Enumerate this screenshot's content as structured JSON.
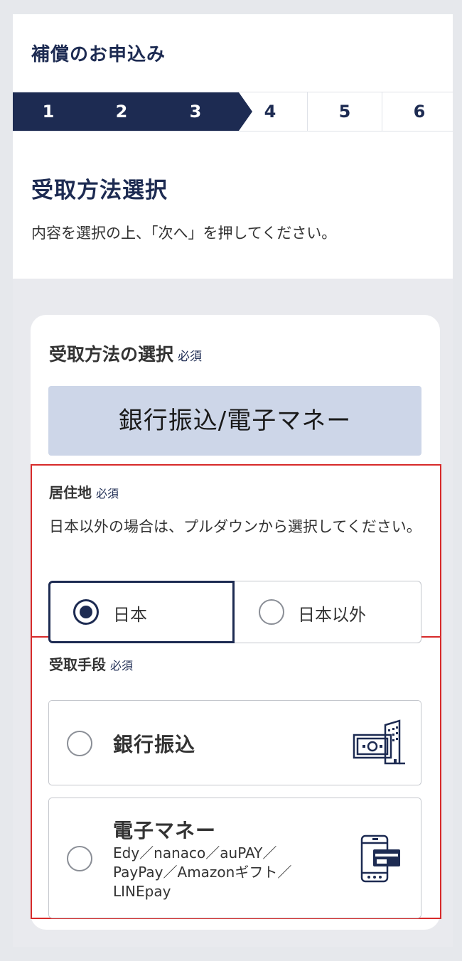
{
  "header": {
    "title": "補償のお申込み"
  },
  "stepper": {
    "steps": [
      "1",
      "2",
      "3",
      "4",
      "5",
      "6"
    ],
    "current_step": 3,
    "colors": {
      "done": "#1d2b52",
      "todo_text": "#1d2b52"
    }
  },
  "page": {
    "heading": "受取方法選択",
    "instruction": "内容を選択の上、「次へ」を押してください。"
  },
  "method_section": {
    "heading": "受取方法の選択",
    "required": "必須",
    "selected_method": "銀行振込/電子マネー"
  },
  "residence": {
    "label": "居住地",
    "required": "必須",
    "note": "日本以外の場合は、プルダウンから選択してください。",
    "options": [
      {
        "label": "日本",
        "selected": true
      },
      {
        "label": "日本以外",
        "selected": false
      }
    ]
  },
  "receiving_means": {
    "label": "受取手段",
    "required": "必須",
    "options": [
      {
        "title": "銀行振込",
        "description": "",
        "icon": "bank-transfer-icon",
        "selected": false
      },
      {
        "title": "電子マネー",
        "description": "Edy／nanaco／auPAY／PayPay／Amazonギフト／LINEpay",
        "icon": "mobile-payment-icon",
        "selected": false
      }
    ]
  },
  "colors": {
    "brand": "#1d2b52",
    "highlight": "#d72a2a",
    "banner": "#cdd6e8"
  }
}
